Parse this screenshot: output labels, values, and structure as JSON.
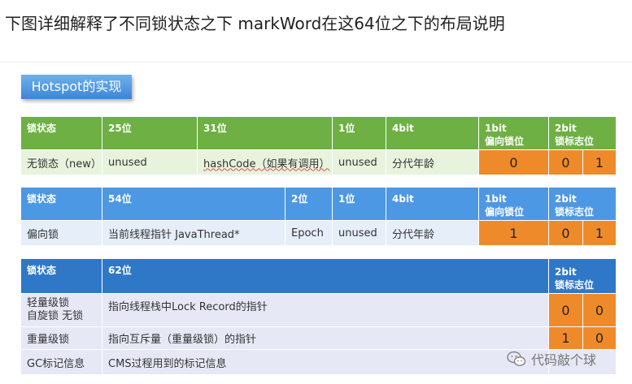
{
  "heading": "下图详细解释了不同锁状态之下 markWord在这64位之下的布局说明",
  "badge": "Hotspot的实现",
  "t1": {
    "headers": [
      "锁状态",
      "25位",
      "31位",
      "1位",
      "4bit",
      "1bit\n偏向锁位",
      "2bit\n锁标志位"
    ],
    "row": [
      "无锁态（new）",
      "unused",
      "hashCode（如果有调用）",
      "unused",
      "分代年龄"
    ],
    "bits": [
      "0",
      "0",
      "1"
    ]
  },
  "t2": {
    "headers": [
      "锁状态",
      "54位",
      "2位",
      "1位",
      "4bit",
      "1bit\n偏向锁位",
      "2bit\n锁标志位"
    ],
    "row": [
      "偏向锁",
      "当前线程指针 JavaThread*",
      "Epoch",
      "unused",
      "分代年龄"
    ],
    "bits": [
      "1",
      "0",
      "1"
    ]
  },
  "t3": {
    "headers": [
      "锁状态",
      "62位",
      "2bit\n锁标志位"
    ],
    "rows": [
      {
        "state": "轻量级锁\n自旋锁 无锁",
        "desc": "指向线程栈中Lock Record的指针",
        "bits": [
          "0",
          "0"
        ]
      },
      {
        "state": "重量级锁",
        "desc": "指向互斥量（重量级锁）的指针",
        "bits": [
          "1",
          "0"
        ]
      },
      {
        "state": "GC标记信息",
        "desc": "CMS过程用到的标记信息",
        "bits": []
      }
    ]
  },
  "watermark": "代码敲个球",
  "icons": {
    "watermark": "wechat-icon"
  }
}
